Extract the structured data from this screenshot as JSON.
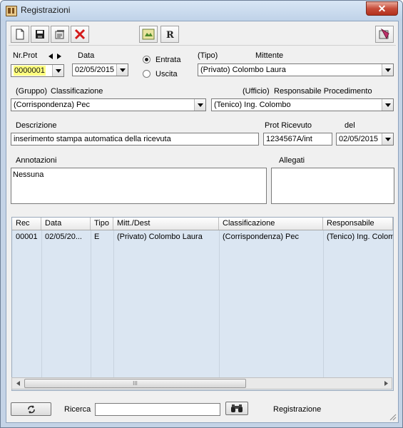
{
  "window": {
    "title": "Registrazioni",
    "close_label": "✕"
  },
  "form": {
    "nrprot_label": "Nr.Prot",
    "nrprot_value": "0000001",
    "data_label": "Data",
    "data_value": "02/05/2015",
    "entrata_label": "Entrata",
    "uscita_label": "Uscita",
    "tipo_label": "(Tipo)",
    "mittente_label": "Mittente",
    "mittente_value": "(Privato) Colombo Laura",
    "gruppo_label": "(Gruppo)",
    "classificazione_label": "Classificazione",
    "classificazione_value": "(Corrispondenza) Pec",
    "ufficio_label": "(Ufficio)",
    "responsabile_label": "Responsabile Procedimento",
    "responsabile_value": "(Tenico) Ing. Colombo",
    "descrizione_label": "Descrizione",
    "descrizione_value": "inserimento stampa automatica della ricevuta",
    "protric_label": "Prot Ricevuto",
    "protric_value": "1234567A/int",
    "del_label": "del",
    "del_value": "02/05/2015",
    "annotazioni_label": "Annotazioni",
    "annotazioni_value": "Nessuna",
    "allegati_label": "Allegati",
    "allegati_value": ""
  },
  "grid": {
    "columns": [
      "Rec",
      "Data",
      "Tipo",
      "Mitt./Dest",
      "Classificazione",
      "Responsabile"
    ],
    "rows": [
      [
        "00001",
        "02/05/20...",
        "E",
        "(Privato) Colombo Laura",
        "(Corrispondenza) Pec",
        "(Tenico) Ing. Colomb"
      ]
    ],
    "scroll_grip": "III"
  },
  "bottom": {
    "ricerca_label": "Ricerca",
    "ricerca_value": "",
    "status": "Registrazione"
  }
}
